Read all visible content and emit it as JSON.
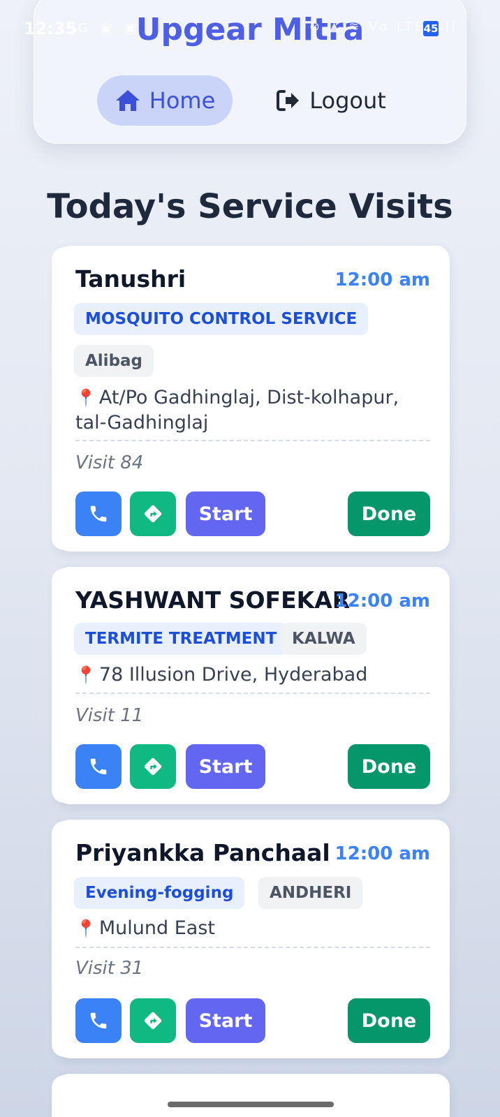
{
  "status_bar": {
    "time": "12:35",
    "left_icons": "G ▣ ▣",
    "right_icons": "⊘ ▲ ≋ Vo LTE .ıll",
    "battery": "45"
  },
  "header": {
    "title": "Upgear Mitra",
    "nav": {
      "home_label": "Home",
      "logout_label": "Logout"
    }
  },
  "page": {
    "title": "Today's Service Visits"
  },
  "visits": [
    {
      "name": "Tanushri",
      "time": "12:00 am",
      "service": "MOSQUITO CONTROL SERVICE",
      "area": "Alibag",
      "address": "At/Po Gadhinglaj, Dist-kolhapur, tal-Gadhinglaj",
      "visit": "Visit 84",
      "start_label": "Start",
      "done_label": "Done"
    },
    {
      "name": "YASHWANT SOFEKAR",
      "time": "12:00 am",
      "service": "TERMITE TREATMENT",
      "area": "KALWA",
      "address": "78 Illusion Drive, Hyderabad",
      "visit": "Visit 11",
      "start_label": "Start",
      "done_label": "Done"
    },
    {
      "name": "Priyankka Panchaal",
      "time": "12:00 am",
      "service": "Evening-fogging",
      "area": "ANDHERI",
      "address": "Mulund East",
      "visit": "Visit 31",
      "start_label": "Start",
      "done_label": "Done"
    }
  ],
  "colors": {
    "brand": "#4f5fe3",
    "call": "#3b82f6",
    "navigate": "#10b981",
    "start": "#6366f1",
    "done": "#059669",
    "time": "#3b82f6"
  }
}
